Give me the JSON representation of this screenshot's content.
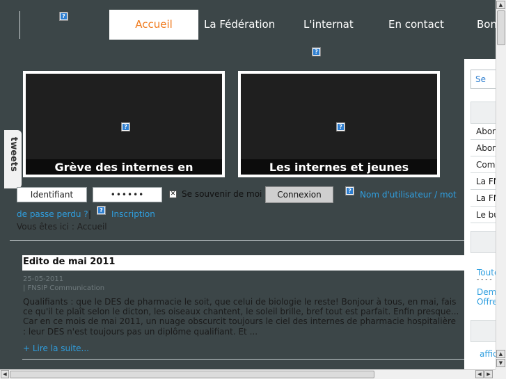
{
  "nav": {
    "tabs": [
      "Accueil",
      "La Fédération",
      "L'internat",
      "En contact",
      "Bon"
    ]
  },
  "slides": [
    {
      "caption": "Grève des internes en"
    },
    {
      "caption": "Les internes et jeunes"
    }
  ],
  "tweets": {
    "label": "tweets"
  },
  "login": {
    "username": "Identifiant",
    "password": "••••••",
    "remember_label": "Se souvenir de moi",
    "submit": "Connexion",
    "forgot_1": "Nom d'utilisateur / mot",
    "forgot_2": "de passe perdu ?",
    "separator": "|",
    "register": "Inscription"
  },
  "breadcrumb": "Vous êtes ici : Accueil",
  "article": {
    "title": "Edito de mai 2011",
    "date": "25-05-2011",
    "author": "| FNSIP Communication",
    "body": "Qualifiants : que le DES de pharmacie le soit, que celui de biologie le reste!   Bonjour à tous, en mai, fais ce qu'il te plaît selon le dicton, les oiseaux chantent, le soleil brille, bref tout est parfait. Enfin presque... Car en ce mois de mai 2011, un nuage obscurcit toujours le ciel des internes de pharmacie hospitalière : leur DES n'est toujours pas un diplôme qualifiant. Et ...",
    "read_more": "+ Lire la suite..."
  },
  "sidebar": {
    "search": "Se",
    "items": [
      "Abon",
      "Abon",
      "Com",
      "La FN",
      "La FN",
      "Le bu"
    ],
    "links": [
      "Toute",
      "- - - -",
      "Dem",
      "Offre"
    ],
    "bottom": "affic"
  },
  "colors": {
    "background": "#3c4648",
    "active_tab_text": "#f07a1c",
    "link": "#2f9fe0"
  }
}
